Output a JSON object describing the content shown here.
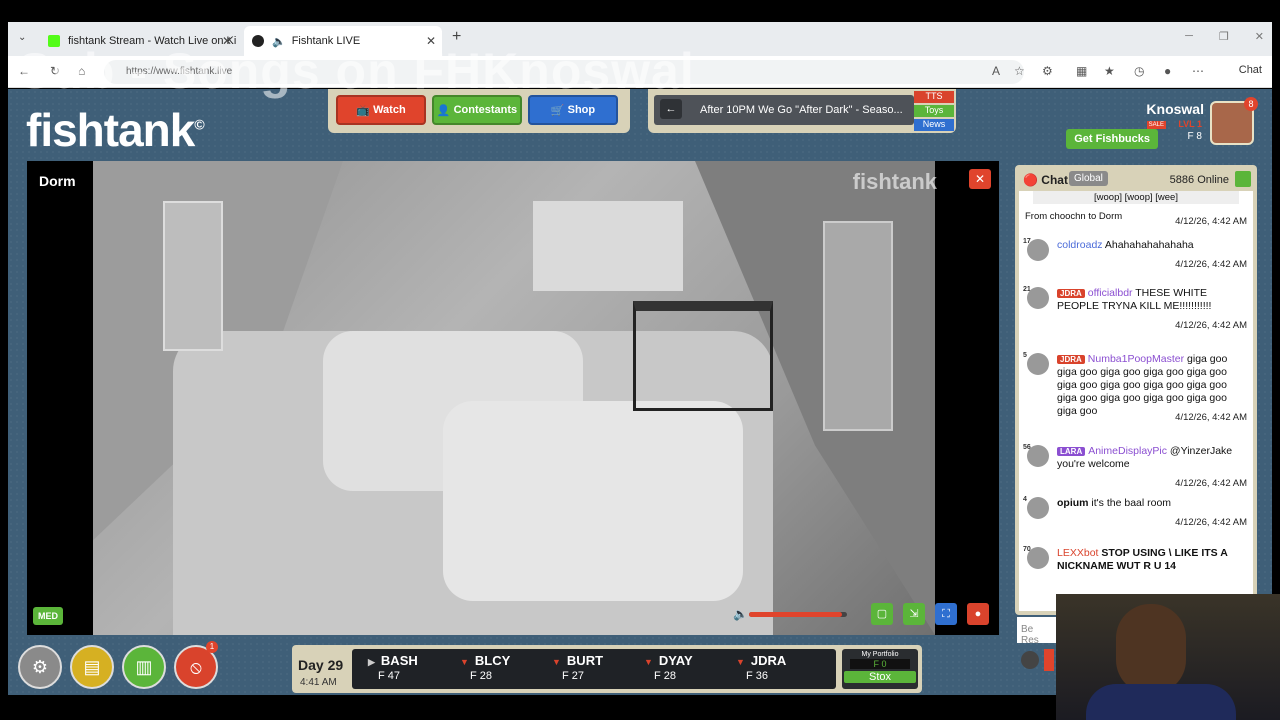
{
  "overlay_text": "Sub - Songs on FHKnoswal",
  "browser": {
    "tabs": [
      {
        "title": "fishtank Stream - Watch Live on Ki",
        "active": false
      },
      {
        "title": "Fishtank LIVE",
        "active": true
      }
    ],
    "url": "https://www.fishtank.live",
    "chat_label": "Chat"
  },
  "site": {
    "logo": "fishtank",
    "logo_mark": "©",
    "nav": {
      "watch": "Watch",
      "contestants": "Contestants",
      "shop": "Shop"
    },
    "ticker": {
      "text": "After 10PM We Go \"After Dark\" - Seaso...",
      "buttons": [
        "TTS",
        "Toys",
        "News"
      ]
    },
    "user": {
      "name": "Knoswal",
      "get_fishbucks": "Get Fishbucks",
      "sale": "SALE",
      "level": "LVL 1",
      "fishbucks": "F 8",
      "notifications": "8"
    }
  },
  "video": {
    "room": "Dorm",
    "watermark": "fishtank",
    "quality": "MED",
    "volume_fraction": 0.95
  },
  "bottom": {
    "notif_count": "1",
    "day": "Day 29",
    "time": "4:41 AM",
    "stocks": [
      {
        "sym": "BASH",
        "price": "F 47",
        "dir": "flat"
      },
      {
        "sym": "BLCY",
        "price": "F 28",
        "dir": "down"
      },
      {
        "sym": "BURT",
        "price": "F 27",
        "dir": "down"
      },
      {
        "sym": "DYAY",
        "price": "F 28",
        "dir": "down"
      },
      {
        "sym": "JDRA",
        "price": "F 36",
        "dir": "down"
      }
    ],
    "portfolio_label": "My Portfolio",
    "portfolio_value": "F 0",
    "stox": "Stox"
  },
  "chat": {
    "title": "Chat",
    "tab": "Global",
    "online": "5886 Online",
    "input_placeholder": "Be Res",
    "messages": [
      {
        "top_text": "[woop] [woop] [wee]",
        "from_line": "From choochn to Dorm",
        "ts": "4/12/26, 4:42 AM"
      },
      {
        "lvl": "17",
        "user": "coldroadz",
        "badge": "",
        "text": "Ahahahahahahaha",
        "ts": "4/12/26, 4:42 AM"
      },
      {
        "lvl": "21",
        "user": "officialbdr",
        "badge": "JDRA",
        "text": "THESE WHITE PEOPLE TRYNA KILL ME!!!!!!!!!!!",
        "ts": "4/12/26, 4:42 AM"
      },
      {
        "lvl": "5",
        "user": "Numba1PoopMaster",
        "badge": "JDRA",
        "text": "giga goo giga goo giga goo giga goo giga goo giga goo giga goo giga goo giga goo giga goo giga goo giga goo giga goo giga goo",
        "ts": "4/12/26, 4:42 AM"
      },
      {
        "lvl": "56",
        "user": "AnimeDisplayPic",
        "badge": "LARA",
        "text": "@YinzerJake you're welcome",
        "ts": "4/12/26, 4:42 AM"
      },
      {
        "lvl": "4",
        "user": "opium",
        "badge": "",
        "text": "it's the baal room",
        "ts": "4/12/26, 4:42 AM"
      },
      {
        "lvl": "70",
        "user": "LEXXbot",
        "badge": "",
        "text": "STOP USING \\ LIKE ITS A NICKNAME WUT R U 14",
        "ts": ""
      }
    ]
  }
}
